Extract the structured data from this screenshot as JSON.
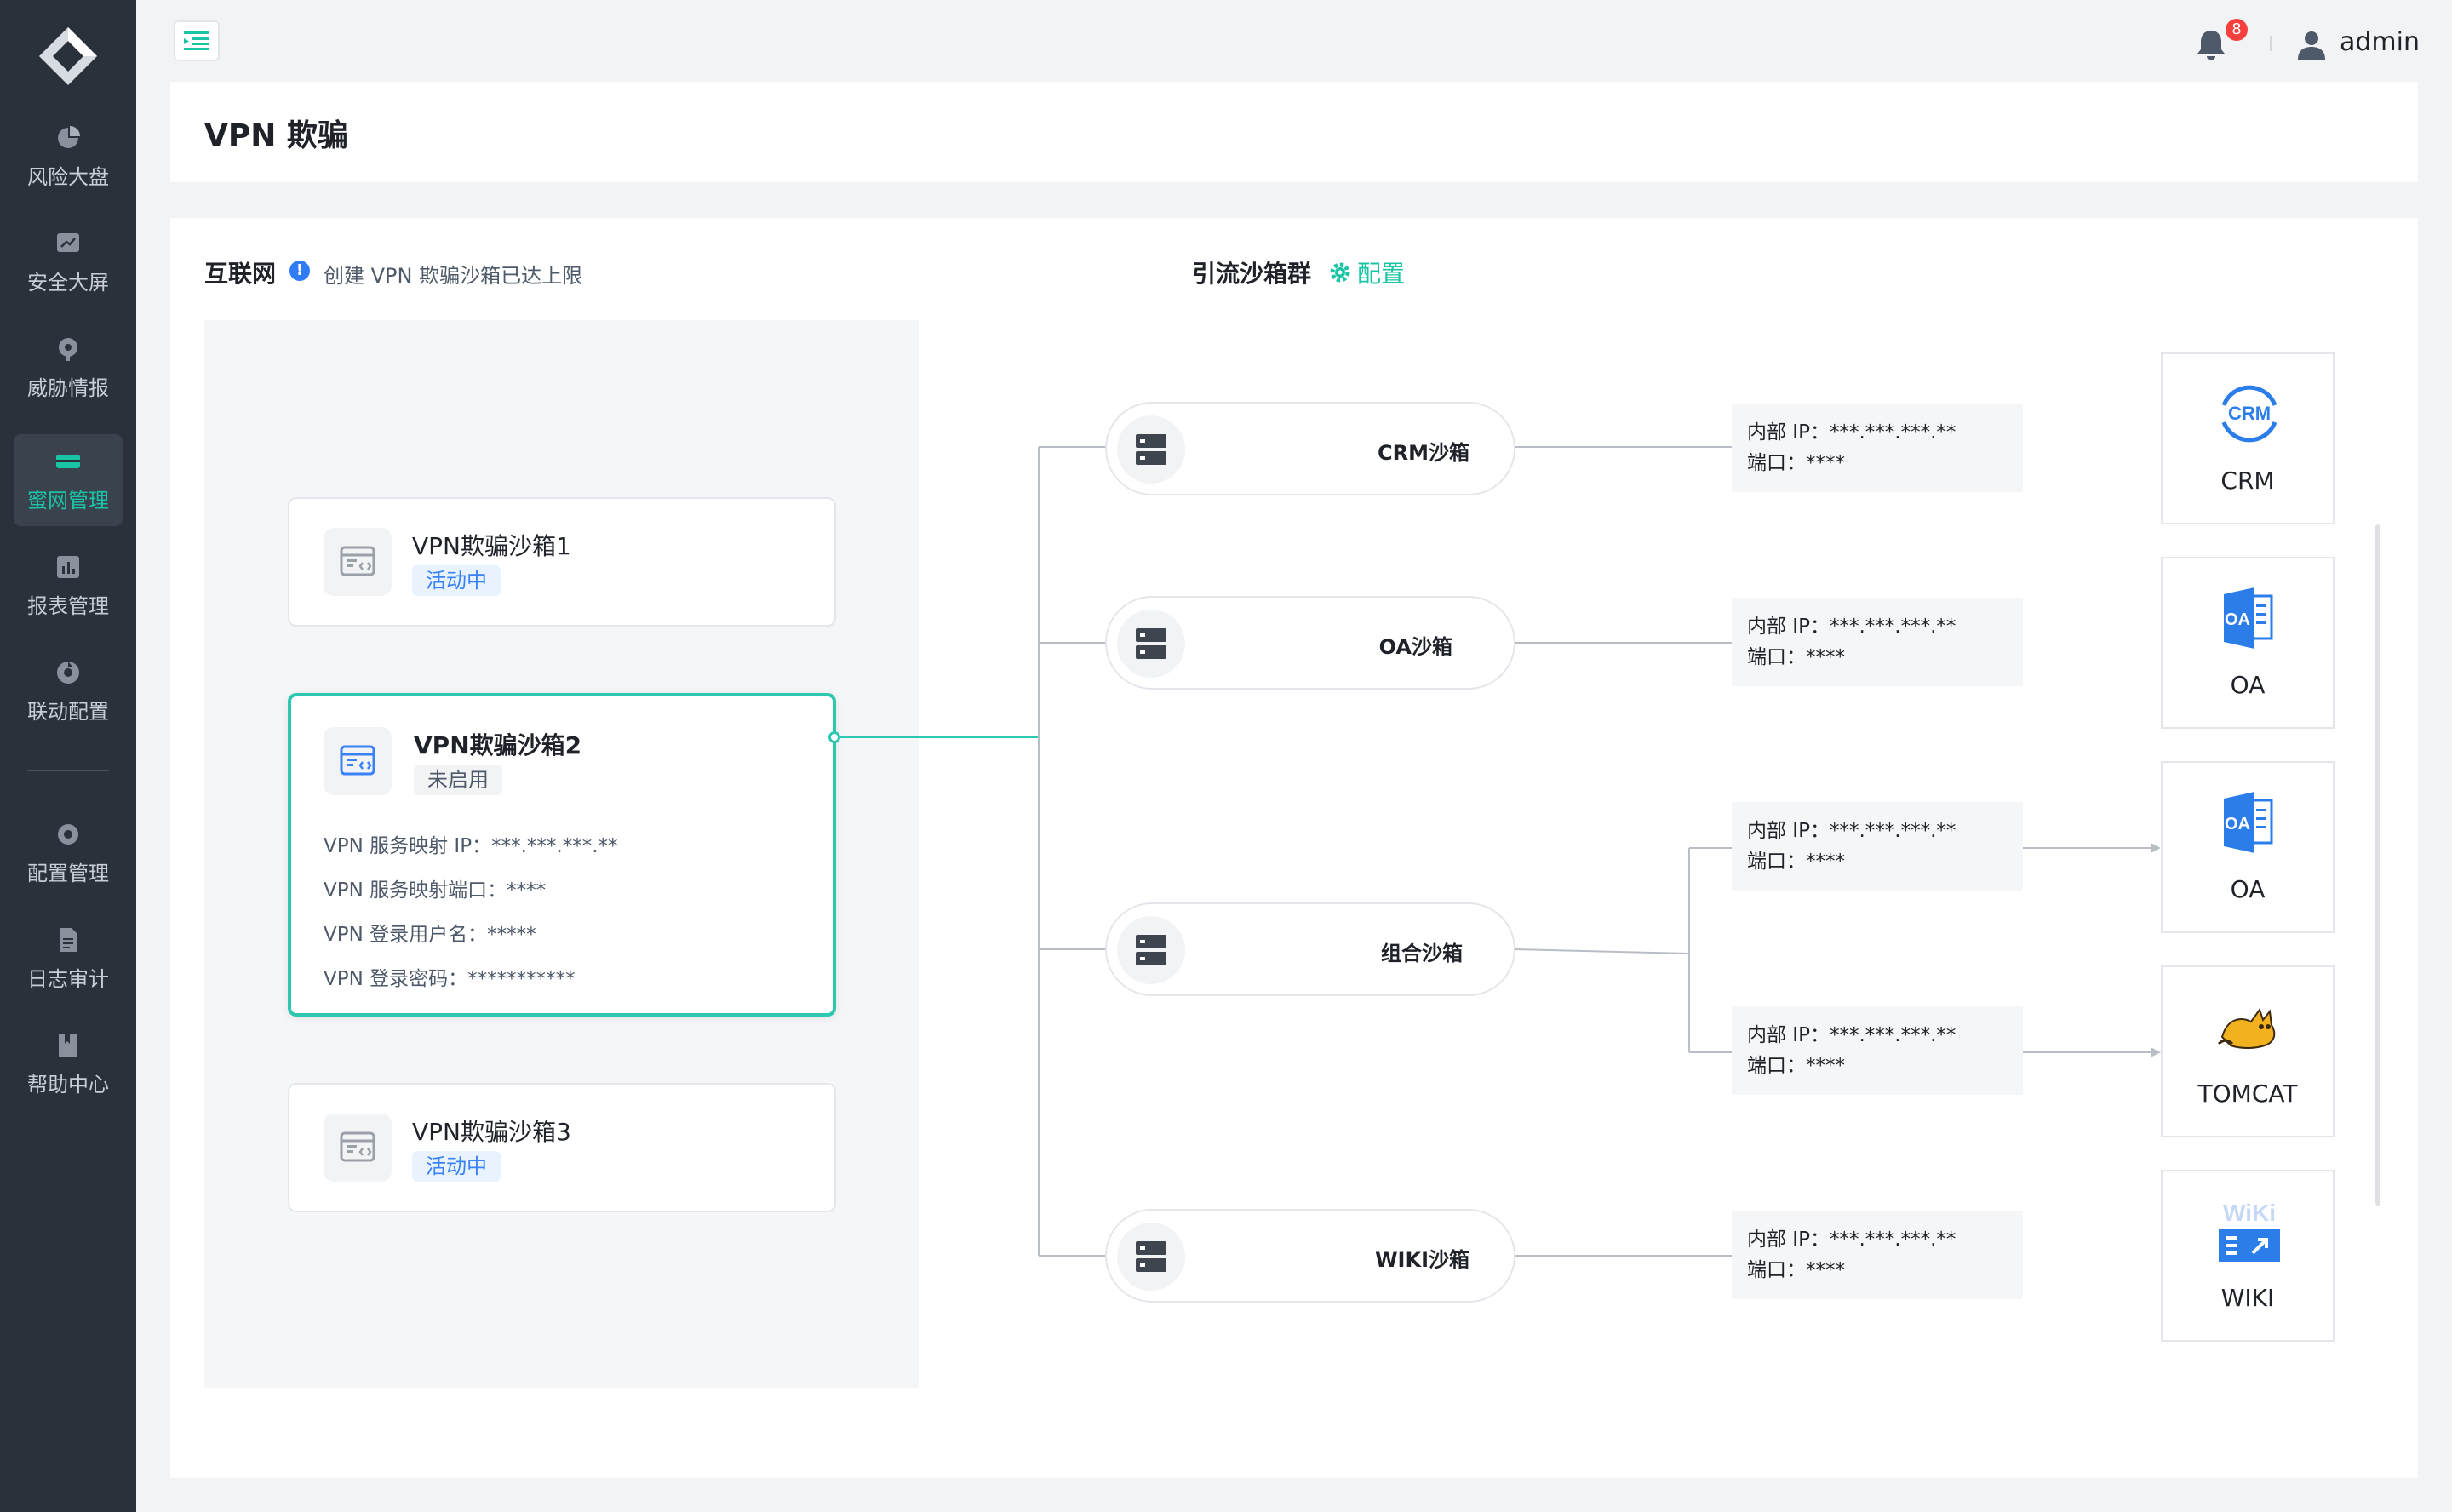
{
  "sidebar": {
    "items": [
      {
        "label": "风险大盘",
        "icon": "pie-chart-icon"
      },
      {
        "label": "安全大屏",
        "icon": "screen-chart-icon"
      },
      {
        "label": "威胁情报",
        "icon": "location-pin-icon"
      },
      {
        "label": "蜜网管理",
        "icon": "network-icon",
        "active": true
      },
      {
        "label": "报表管理",
        "icon": "bar-chart-icon"
      },
      {
        "label": "联动配置",
        "icon": "linkage-icon"
      },
      {
        "label": "配置管理",
        "icon": "gear-icon"
      },
      {
        "label": "日志审计",
        "icon": "document-icon"
      },
      {
        "label": "帮助中心",
        "icon": "book-icon"
      }
    ]
  },
  "header": {
    "notification_count": "8",
    "user_name": "admin"
  },
  "page": {
    "title": "VPN 欺骗"
  },
  "internet": {
    "title": "互联网",
    "info_icon": "!",
    "info_text": "创建 VPN 欺骗沙箱已达上限"
  },
  "vpn_sandboxes": [
    {
      "name": "VPN欺骗沙箱1",
      "status": "活动中"
    },
    {
      "name": "VPN欺骗沙箱2",
      "status": "未启用",
      "details": [
        "VPN 服务映射 IP：***.***.***.**",
        "VPN 服务映射端口：****",
        "VPN 登录用户名：*****",
        "VPN 登录密码：***********"
      ]
    },
    {
      "name": "VPN欺骗沙箱3",
      "status": "活动中"
    }
  ],
  "diversion": {
    "title": "引流沙箱群",
    "config_label": "配置",
    "sandboxes": [
      {
        "label": "CRM沙箱"
      },
      {
        "label": "OA沙箱"
      },
      {
        "label": "组合沙箱"
      },
      {
        "label": "WIKI沙箱"
      }
    ],
    "endpoints": [
      {
        "ip": "内部 IP：***.***.***.**",
        "port": "端口：****"
      },
      {
        "ip": "内部 IP：***.***.***.**",
        "port": "端口：****"
      },
      {
        "ip": "内部 IP：***.***.***.**",
        "port": "端口：****"
      },
      {
        "ip": "内部 IP：***.***.***.**",
        "port": "端口：****"
      },
      {
        "ip": "内部 IP：***.***.***.**",
        "port": "端口：****"
      }
    ],
    "services": [
      {
        "label": "CRM",
        "logo_text": "CRM"
      },
      {
        "label": "OA",
        "logo_text": "OA"
      },
      {
        "label": "OA",
        "logo_text": "OA"
      },
      {
        "label": "TOMCAT"
      },
      {
        "label": "WIKI",
        "logo_text": "WiKi"
      }
    ]
  },
  "colors": {
    "sidebar_bg": "#2b313b",
    "accent": "#19c5a5",
    "selected_border": "#2ec7b0",
    "active_tag": "#3a82f7",
    "badge": "#f5403d"
  }
}
